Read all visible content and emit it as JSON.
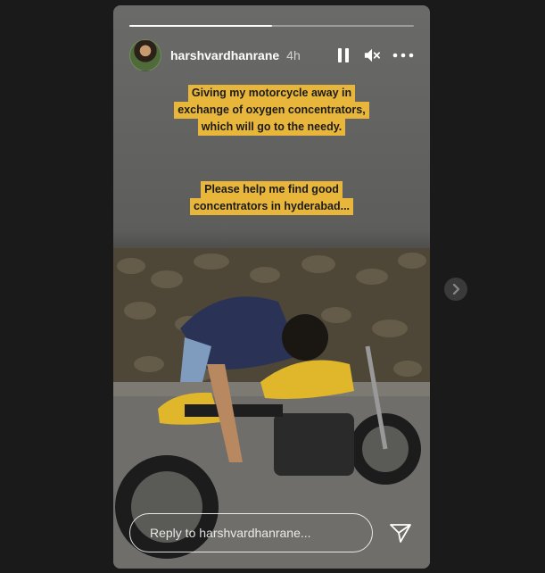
{
  "story": {
    "username": "harshvardhanrane",
    "timestamp": "4h",
    "progress": 0.5,
    "caption_1": [
      "Giving my motorcycle away in",
      "exchange of oxygen concentrators,",
      "which will go to the needy."
    ],
    "caption_2": [
      "Please help me find good",
      "concentrators in hyderabad..."
    ],
    "reply_placeholder": "Reply to harshvardhanrane...",
    "caption_color": "#e8b63a"
  },
  "controls": {
    "pause_icon": "pause-icon",
    "mute_icon": "speaker-muted-icon",
    "more_icon": "more-dots-icon",
    "send_icon": "send-icon",
    "next_icon": "chevron-right-icon"
  }
}
